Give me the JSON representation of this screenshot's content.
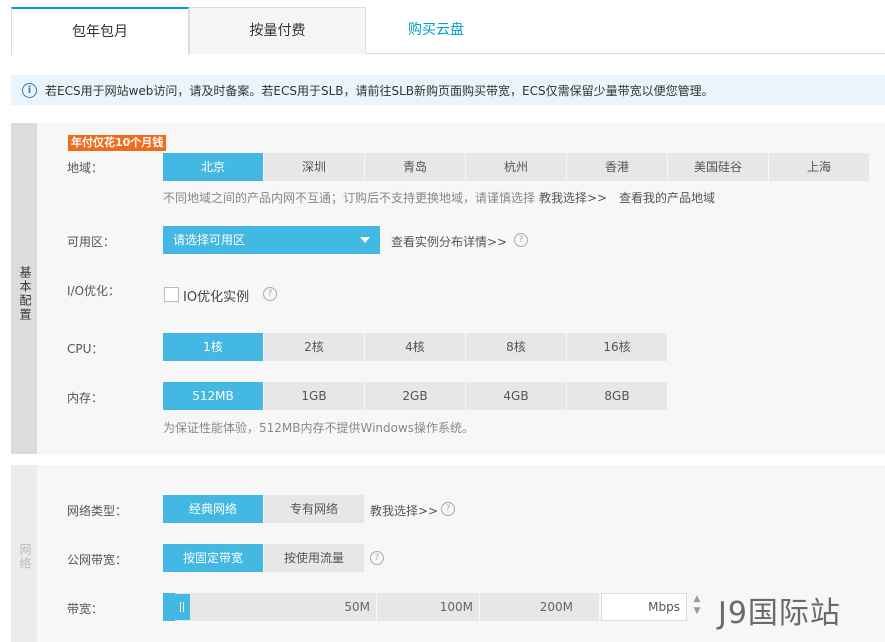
{
  "tabs": {
    "monthly": "包年包月",
    "payg": "按量付费",
    "disk": "购买云盘"
  },
  "notice": {
    "text": "若ECS用于网站web访问，请及时备案。若ECS用于SLB，请前往SLB新购页面购买带宽，ECS仅需保留少量带宽以便您管理。"
  },
  "basic": {
    "section_label": "基本配置",
    "promo": "年付仅花10个月钱",
    "region": {
      "label": "地域：",
      "options": [
        "北京",
        "深圳",
        "青岛",
        "杭州",
        "香港",
        "美国硅谷",
        "上海"
      ],
      "selected": "北京",
      "hint": "不同地域之间的产品内网不互通；订购后不支持更换地域，请谨慎选择",
      "help_link": "教我选择>>",
      "my_link": "查看我的产品地域"
    },
    "zone": {
      "label": "可用区：",
      "value": "请选择可用区",
      "link": "查看实例分布详情>>"
    },
    "io": {
      "label": "I/O优化：",
      "checkbox_label": "IO优化实例"
    },
    "cpu": {
      "label": "CPU：",
      "options": [
        "1核",
        "2核",
        "4核",
        "8核",
        "16核"
      ],
      "selected": "1核"
    },
    "memory": {
      "label": "内存：",
      "options": [
        "512MB",
        "1GB",
        "2GB",
        "4GB",
        "8GB"
      ],
      "selected": "512MB",
      "hint": "为保证性能体验，512MB内存不提供Windows操作系统。"
    }
  },
  "network": {
    "section_label": "网络",
    "type": {
      "label": "网络类型：",
      "options": [
        "经典网络",
        "专有网络"
      ],
      "selected": "经典网络",
      "link": "教我选择>>"
    },
    "bandwidth_mode": {
      "label": "公网带宽：",
      "options": [
        "按固定带宽",
        "按使用流量"
      ],
      "selected": "按固定带宽"
    },
    "bandwidth": {
      "label": "带宽：",
      "ticks": [
        "50M",
        "100M",
        "200M"
      ],
      "unit": "Mbps",
      "value_fraction": 0.03
    }
  },
  "watermark": "J9国际站",
  "colors": {
    "accent": "#43b8e2",
    "link": "#00a2ca",
    "promo": "#f06b1b"
  }
}
